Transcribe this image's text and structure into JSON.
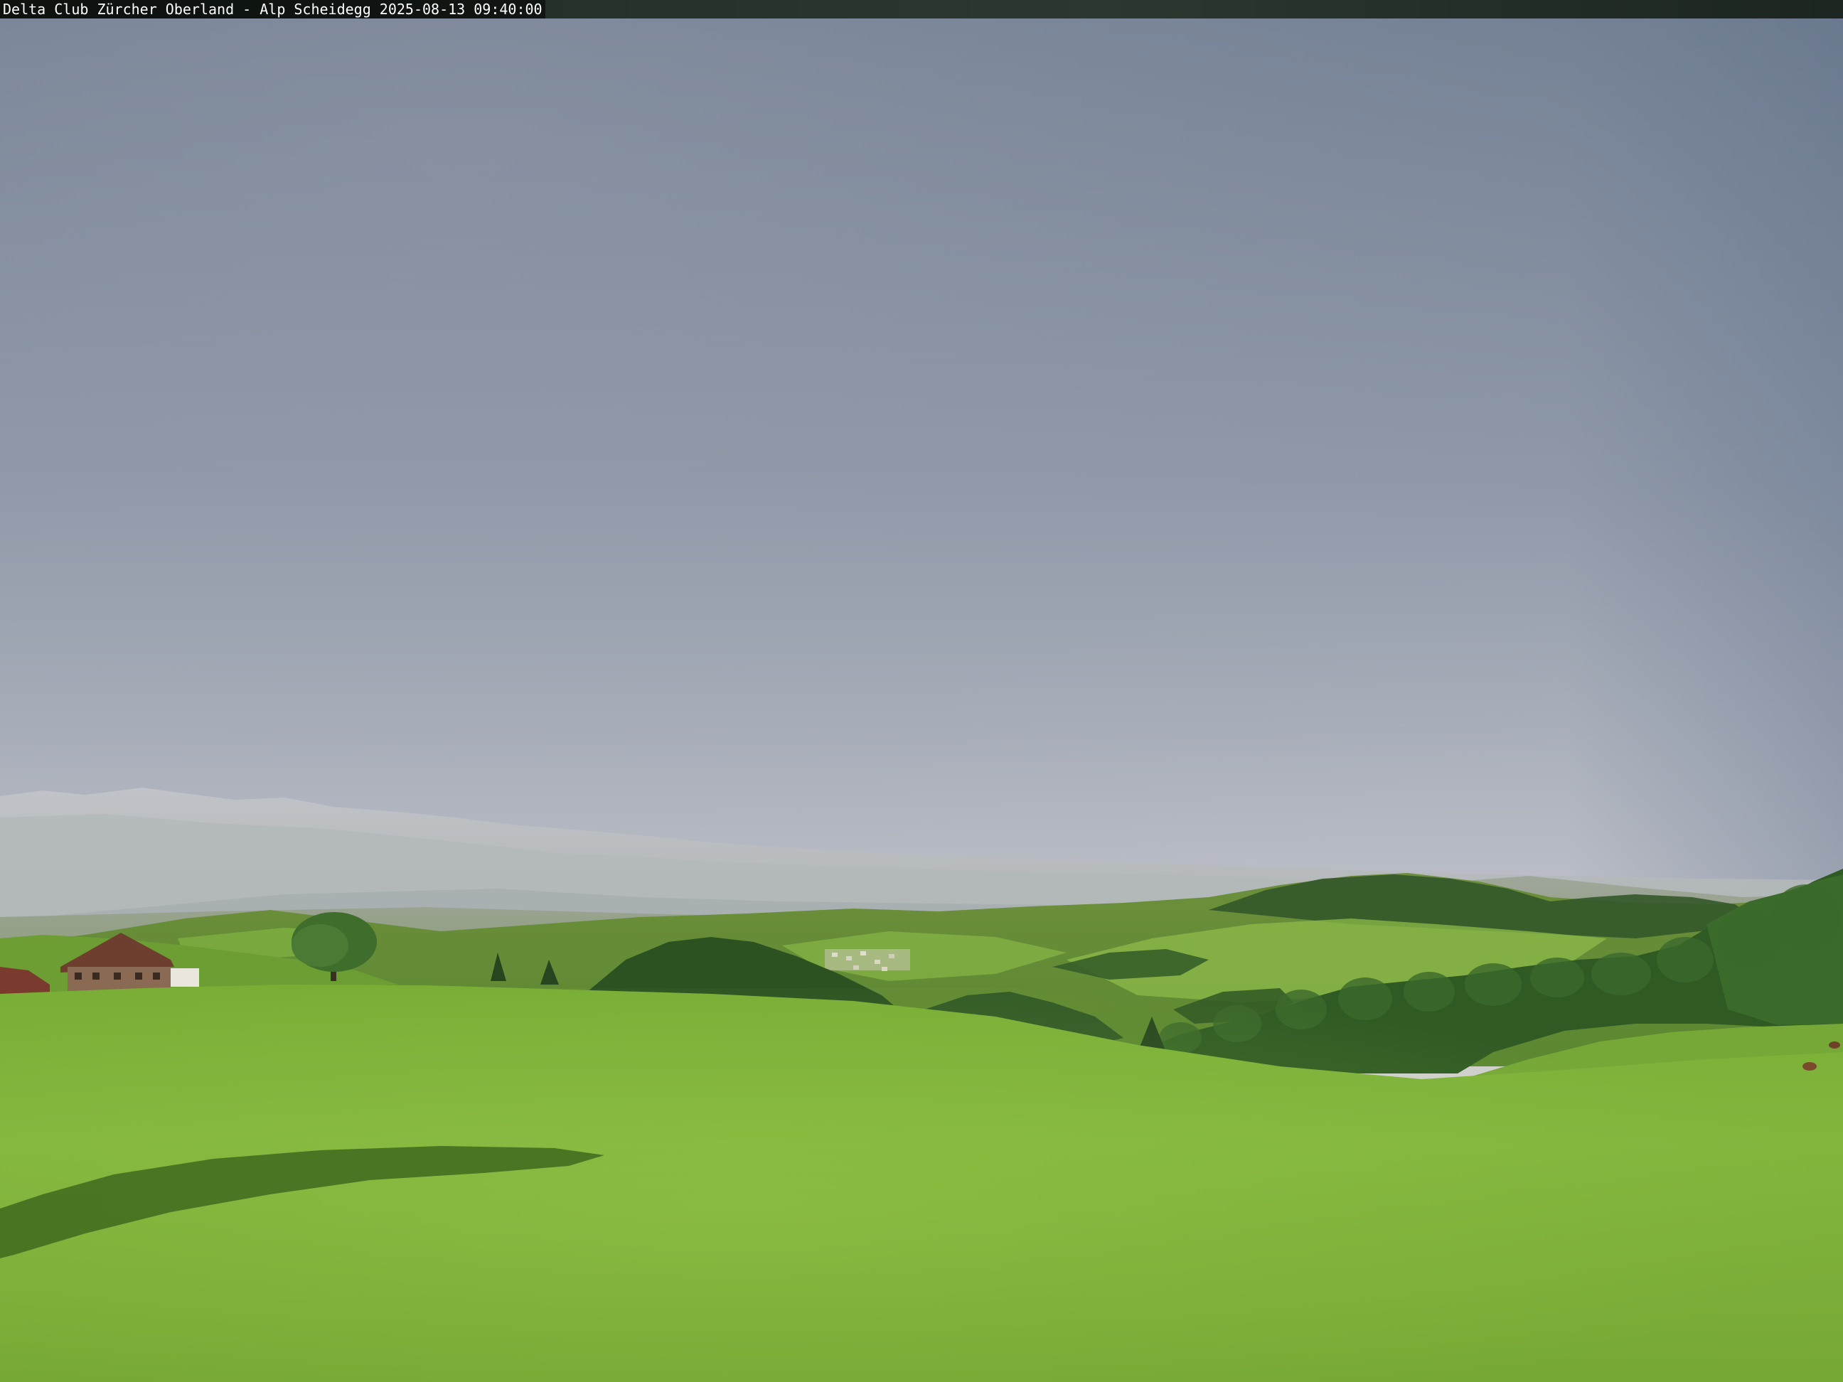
{
  "caption": {
    "text": "Delta Club Zürcher Oberland - Alp Scheidegg 2025-08-13 09:40:00"
  },
  "scene": {
    "description_name": "alpine-meadow-webcam-view"
  },
  "colors": {
    "sky_top": "#6f7d92",
    "sky_mid": "#a9afbd",
    "sky_horizon": "#e6e3dc",
    "meadow_near": "#7fb43a",
    "meadow_far": "#6da531",
    "forest": "#2f5a24",
    "haze_mountains": "#b9bec3"
  }
}
